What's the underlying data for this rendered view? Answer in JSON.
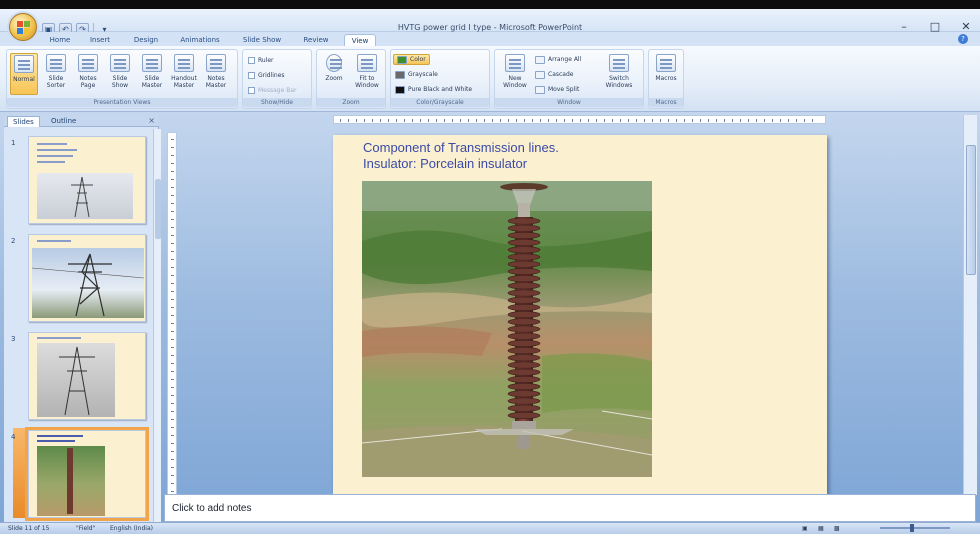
{
  "window": {
    "title": "HVTG power grid I type - Microsoft PowerPoint",
    "minimize": "–",
    "maximize": "□",
    "close": "✕"
  },
  "quick_access": [
    "save-icon",
    "undo-icon",
    "redo-icon",
    "customize-icon"
  ],
  "ribbon_tabs": [
    "Home",
    "Insert",
    "Design",
    "Animations",
    "Slide Show",
    "Review",
    "View"
  ],
  "active_tab": "View",
  "ribbon": {
    "presentation_views": {
      "label": "Presentation Views",
      "buttons": [
        "Normal",
        "Slide Sorter",
        "Notes Page",
        "Slide Show",
        "Slide Master",
        "Handout Master",
        "Notes Master"
      ]
    },
    "show_hide": {
      "label": "Show/Hide",
      "items": [
        "Ruler",
        "Gridlines",
        "Message Bar"
      ]
    },
    "zoom": {
      "label": "Zoom",
      "buttons": [
        "Zoom",
        "Fit to Window"
      ]
    },
    "color_grayscale": {
      "label": "Color/Grayscale",
      "items": [
        "Color",
        "Grayscale",
        "Pure Black and White"
      ]
    },
    "window": {
      "label": "Window",
      "new_window": "New Window",
      "items": [
        "Arrange All",
        "Cascade",
        "Move Split"
      ],
      "switch": "Switch Windows"
    },
    "macros": {
      "label": "Macros",
      "button": "Macros"
    }
  },
  "pane": {
    "tabs": [
      "Slides",
      "Outline"
    ],
    "close": "×",
    "slides": [
      {
        "num": "1"
      },
      {
        "num": "2"
      },
      {
        "num": "3"
      },
      {
        "num": "4"
      }
    ]
  },
  "slide": {
    "title_line1": "Component of Transmission lines.",
    "title_line2": "Insulator: Porcelain insulator"
  },
  "notes": {
    "placeholder": "Click to add notes"
  },
  "status": {
    "slide": "Slide 11 of 15",
    "theme": "\"Field\"",
    "language": "English (India)"
  },
  "colors": {
    "slide_background": "#fbf0cf",
    "title_text": "#3a4aa8",
    "active_button": "#f7c455"
  }
}
